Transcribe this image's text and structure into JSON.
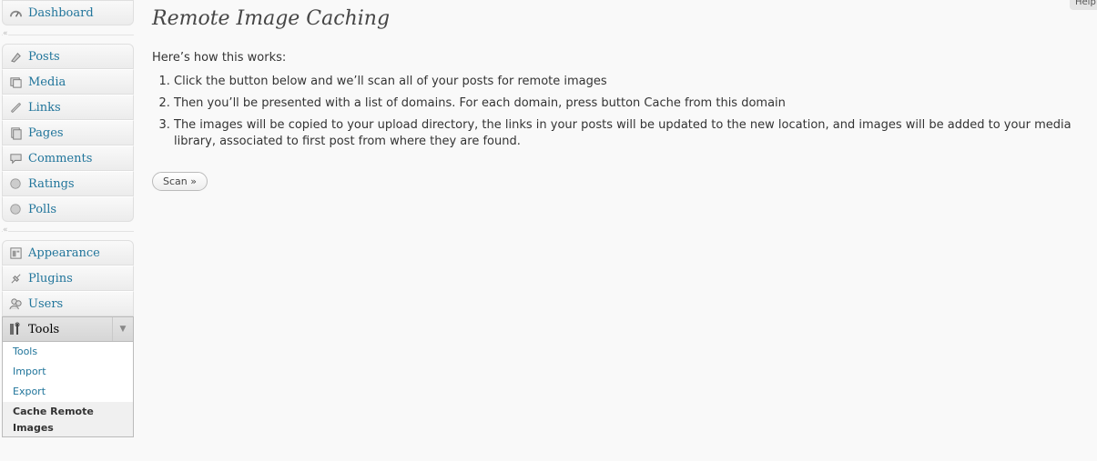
{
  "sidebar": {
    "groups": [
      [
        {
          "label": "Dashboard",
          "icon": "dashboard-icon"
        }
      ],
      [
        {
          "label": "Posts",
          "icon": "posts-icon"
        },
        {
          "label": "Media",
          "icon": "media-icon"
        },
        {
          "label": "Links",
          "icon": "links-icon"
        },
        {
          "label": "Pages",
          "icon": "pages-icon"
        },
        {
          "label": "Comments",
          "icon": "comments-icon"
        },
        {
          "label": "Ratings",
          "icon": "ratings-icon"
        },
        {
          "label": "Polls",
          "icon": "polls-icon"
        }
      ],
      [
        {
          "label": "Appearance",
          "icon": "appearance-icon"
        },
        {
          "label": "Plugins",
          "icon": "plugins-icon"
        },
        {
          "label": "Users",
          "icon": "users-icon"
        }
      ]
    ],
    "separator_arrow": "«",
    "tools": {
      "label": "Tools",
      "toggle": "▼",
      "submenu": [
        {
          "label": "Tools"
        },
        {
          "label": "Import"
        },
        {
          "label": "Export"
        },
        {
          "label": "Cache Remote Images",
          "current": true
        }
      ]
    }
  },
  "page": {
    "title": "Remote Image Caching",
    "intro": "Here’s how this works:",
    "steps": [
      "Click the button below and we’ll scan all of your posts for remote images",
      "Then you’ll be presented with a list of domains. For each domain, press button Cache from this domain",
      "The images will be copied to your upload directory, the links in your posts will be updated to the new location, and images will be added to your media library, associated to first post from where they are found."
    ],
    "scan_button": "Scan »"
  },
  "help_tab": "Help"
}
